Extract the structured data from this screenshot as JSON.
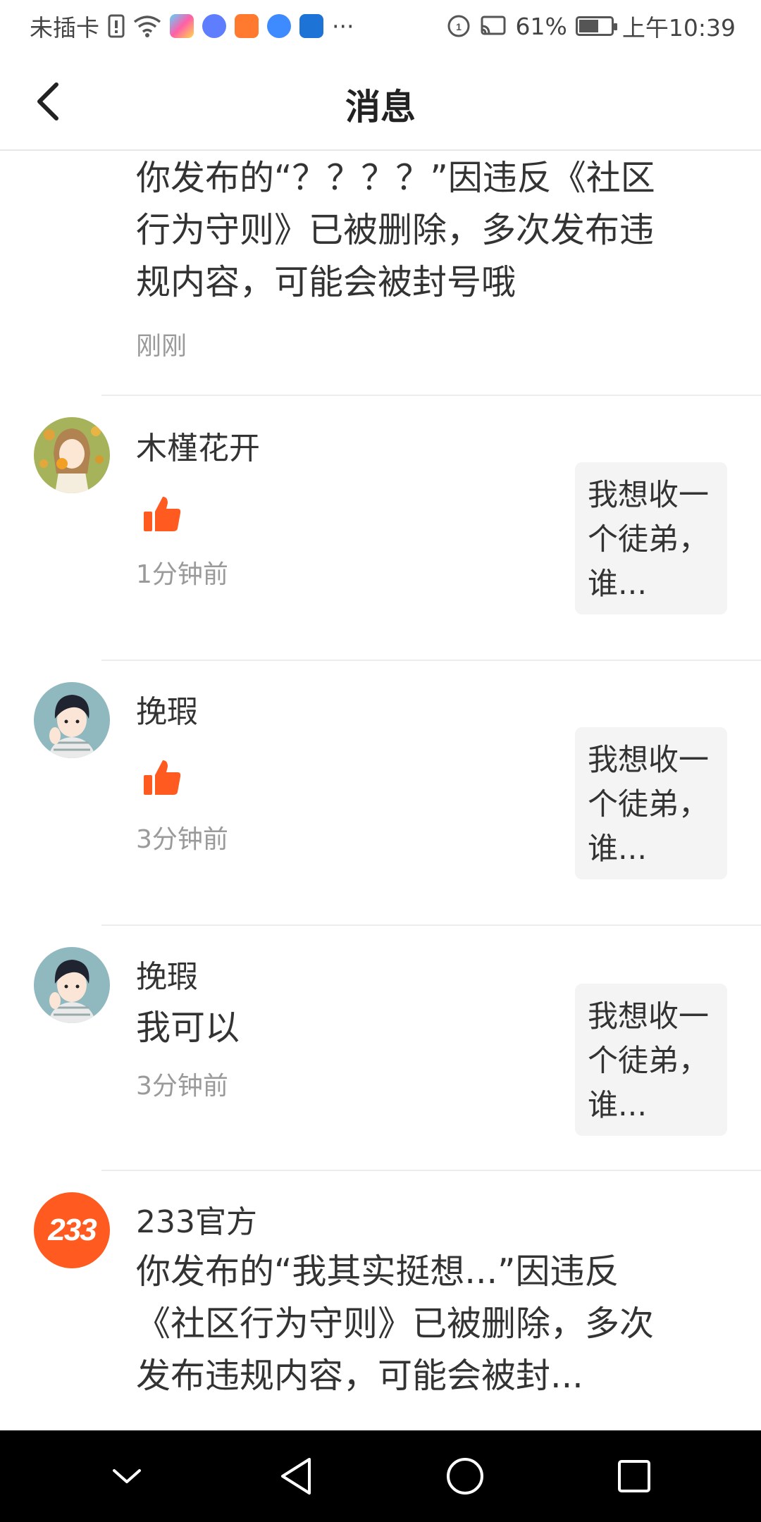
{
  "status_bar": {
    "carrier": "未插卡",
    "more": "···",
    "battery": "61%",
    "time": "上午10:39",
    "battery_level": 0.61
  },
  "header": {
    "title": "消息"
  },
  "messages": [
    {
      "text": "你发布的“？？？？”因违反《社区行为守则》已被删除，多次发布违规内容，可能会被封号哦",
      "time": "刚刚"
    },
    {
      "name": "木槿花开",
      "time": "1分钟前",
      "quote": "我想收一个徒弟，谁..."
    },
    {
      "name": "挽瑕",
      "time": "3分钟前",
      "quote": "我想收一个徒弟，谁..."
    },
    {
      "name": "挽瑕",
      "text": "我可以",
      "time": "3分钟前",
      "quote": "我想收一个徒弟，谁..."
    },
    {
      "name": "233官方",
      "avatar_text": "233",
      "text": "你发布的“我其实挺想...”因违反《社区行为守则》已被删除，多次发布违规内容，可能会被封..."
    }
  ],
  "colors": {
    "accent": "#ff5a1f",
    "like": "#ff5a1f",
    "time": "#9a9a9a"
  },
  "icons": {
    "back": "chevron-left-icon",
    "like": "thumbs-up-icon",
    "nav_down": "chevron-down-icon",
    "nav_back": "triangle-back-icon",
    "nav_home": "circle-home-icon",
    "nav_recents": "square-recents-icon"
  }
}
